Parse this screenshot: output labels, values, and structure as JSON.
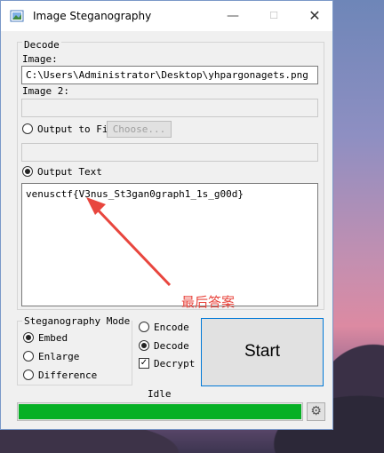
{
  "window": {
    "title": "Image Steganography",
    "controls": {
      "minimize": "—",
      "maximize": "☐",
      "close": "✕"
    }
  },
  "decode": {
    "group_label": "Decode",
    "image_label": "Image:",
    "image_value": "C:\\Users\\Administrator\\Desktop\\yhpargonagets.png",
    "image2_label": "Image 2:",
    "image2_value": "",
    "output_file_label": "Output to Fil",
    "choose_label": "Choose...",
    "output_file_value": "",
    "output_text_label": "Output Text",
    "output_text_value": "venusctf{V3nus_St3gan0graph1_1s_g00d}"
  },
  "mode": {
    "group_label": "Steganography Mode",
    "options": [
      "Embed",
      "Enlarge",
      "Difference"
    ],
    "selected": "Embed"
  },
  "action": {
    "encode_label": "Encode",
    "decode_label": "Decode",
    "decrypt_label": "Decrypt",
    "selected": "Decode",
    "decrypt_checked": true
  },
  "start_label": "Start",
  "status": "Idle",
  "progress": 1.0,
  "annotation_text": "最后答案",
  "colors": {
    "annotation": "#e8463e",
    "progress": "#06b025",
    "focus_border": "#0078d7"
  }
}
